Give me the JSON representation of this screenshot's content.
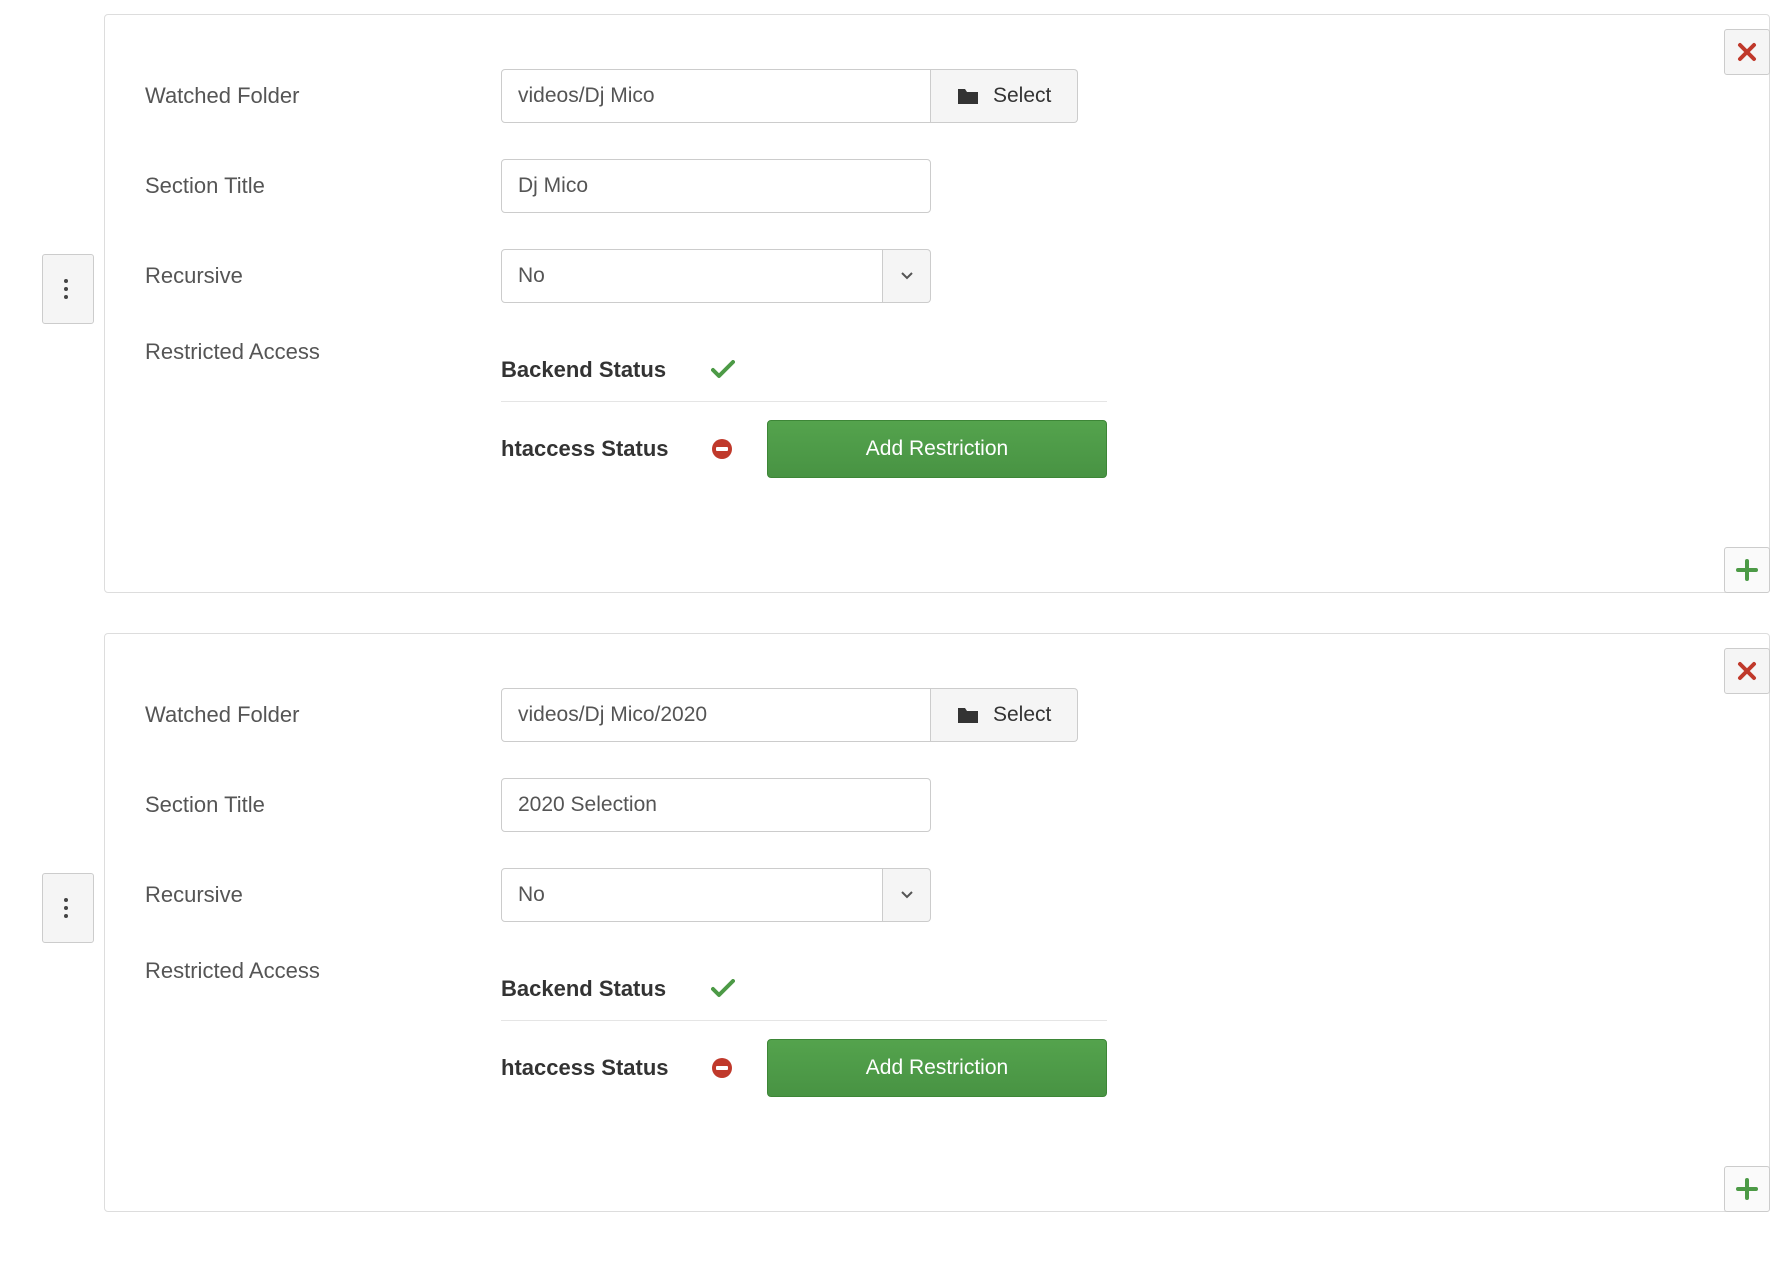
{
  "labels": {
    "watched_folder": "Watched Folder",
    "section_title": "Section Title",
    "recursive": "Recursive",
    "restricted_access": "Restricted Access",
    "backend_status": "Backend Status",
    "htaccess_status": "htaccess Status",
    "select_button": "Select",
    "add_restriction": "Add Restriction"
  },
  "cards": [
    {
      "watched_folder": "videos/Dj Mico",
      "section_title": "Dj Mico",
      "recursive": "No",
      "backend_ok": true,
      "htaccess_ok": false
    },
    {
      "watched_folder": "videos/Dj Mico/2020",
      "section_title": "2020 Selection",
      "recursive": "No",
      "backend_ok": true,
      "htaccess_ok": false
    }
  ],
  "colors": {
    "green": "#4c9a46",
    "check": "#4c9a46",
    "deny": "#c0392b",
    "close": "#c0392b"
  }
}
